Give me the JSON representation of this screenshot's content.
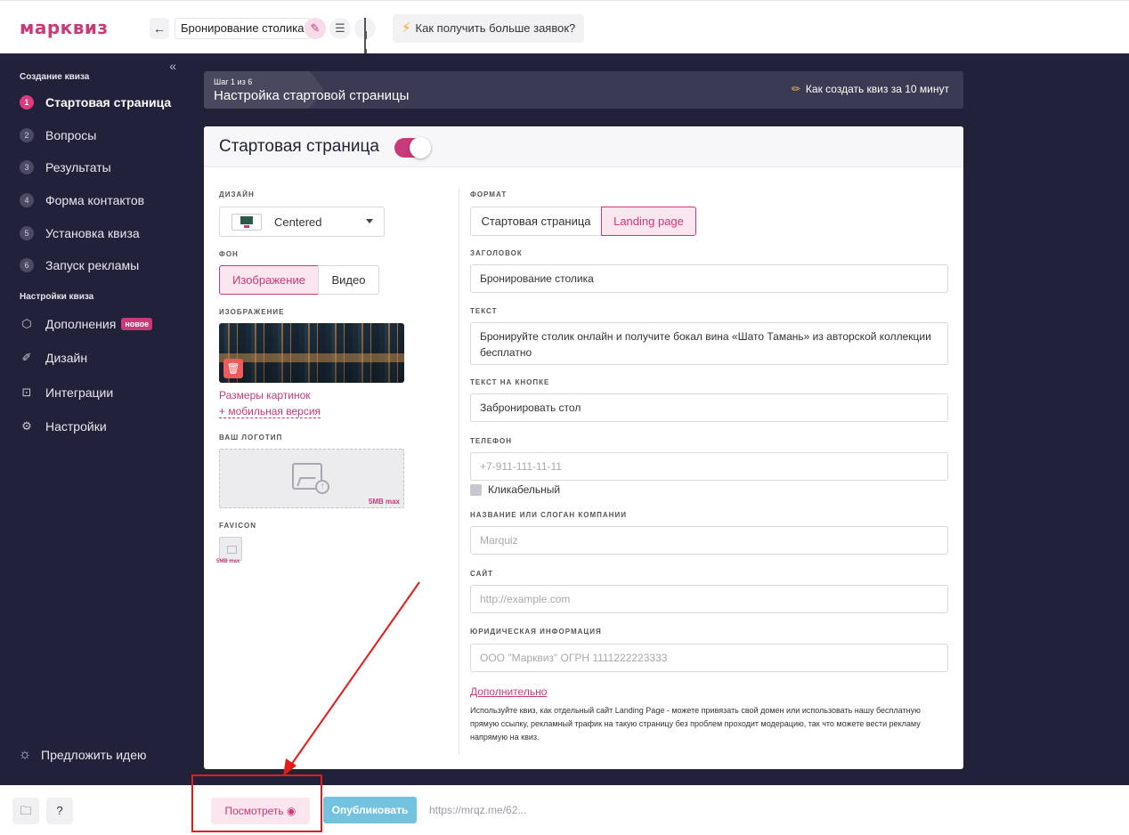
{
  "header": {
    "logo": "марквиз",
    "back_icon": "arrow-left-icon",
    "quiz_name": "Бронирование столика",
    "promo_label": "Как получить больше заявок?"
  },
  "sidebar": {
    "section_create": "Создание квиза",
    "steps": [
      {
        "num": "1",
        "label": "Стартовая страница"
      },
      {
        "num": "2",
        "label": "Вопросы"
      },
      {
        "num": "3",
        "label": "Результаты"
      },
      {
        "num": "4",
        "label": "Форма контактов"
      },
      {
        "num": "5",
        "label": "Установка квиза"
      },
      {
        "num": "6",
        "label": "Запуск рекламы"
      }
    ],
    "section_settings": "Настройки квиза",
    "settings": [
      {
        "label": "Дополнения",
        "badge": "новое",
        "icon": "puzzle-icon"
      },
      {
        "label": "Дизайн",
        "icon": "brush-icon"
      },
      {
        "label": "Интеграции",
        "icon": "plug-icon"
      },
      {
        "label": "Настройки",
        "icon": "gear-icon"
      }
    ],
    "suggest_idea": "Предложить идею"
  },
  "stepbar": {
    "step_counter": "Шаг 1 из 6",
    "step_title": "Настройка стартовой страницы",
    "help_link": "Как создать квиз за 10 минут"
  },
  "card": {
    "title": "Стартовая страница",
    "enabled": true,
    "left": {
      "design_label": "ДИЗАЙН",
      "design_value": "Centered",
      "bg_label": "ФОН",
      "bg_options": [
        "Изображение",
        "Видео"
      ],
      "bg_selected": "Изображение",
      "image_label": "ИЗОБРАЖЕНИЕ",
      "image_sizes_link": "Размеры картинок",
      "mobile_link": "+ мобильная версия",
      "logo_label": "ВАШ ЛОГОТИП",
      "logo_max": "5MB max",
      "favicon_label": "FAVICON",
      "favicon_max": "5MB max"
    },
    "right": {
      "format_label": "ФОРМАТ",
      "format_options": [
        "Стартовая страница",
        "Landing page"
      ],
      "format_selected": "Landing page",
      "heading_label": "ЗАГОЛОВОК",
      "heading_value": "Бронирование столика",
      "text_label": "ТЕКСТ",
      "text_value": "Бронируйте столик онлайн и получите бокал вина «Шато Тамань» из авторской коллекции бесплатно",
      "button_text_label": "ТЕКСТ НА КНОПКЕ",
      "button_text_value": "Забронировать стол",
      "phone_label": "ТЕЛЕФОН",
      "phone_placeholder": "+7-911-111-11-11",
      "clickable_label": "Кликабельный",
      "company_label": "НАЗВАНИЕ ИЛИ СЛОГАН КОМПАНИИ",
      "company_placeholder": "Marquiz",
      "site_label": "САЙТ",
      "site_placeholder": "http://example.com",
      "legal_label": "ЮРИДИЧЕСКАЯ ИНФОРМАЦИЯ",
      "legal_placeholder": "ООО \"Марквиз\" ОГРН 1111222223333",
      "more_link": "Дополнительно",
      "note": "Используйте квиз, как отдельный сайт Landing Page - можете привязать свой домен или использовать нашу бесплатную прямую ссылку, рекламный трафик на такую страницу без проблем проходит модерацию, так что можете вести рекламу напрямую на квиз."
    }
  },
  "bottombar": {
    "help_label": "?",
    "view_label": "Посмотреть",
    "publish_label": "Опубликовать",
    "url": "https://mrqz.me/62..."
  },
  "colors": {
    "brand": "#c93a78",
    "sidebar_bg": "#21213a",
    "publish": "#72c2e0",
    "annotation": "#e21b1b"
  }
}
